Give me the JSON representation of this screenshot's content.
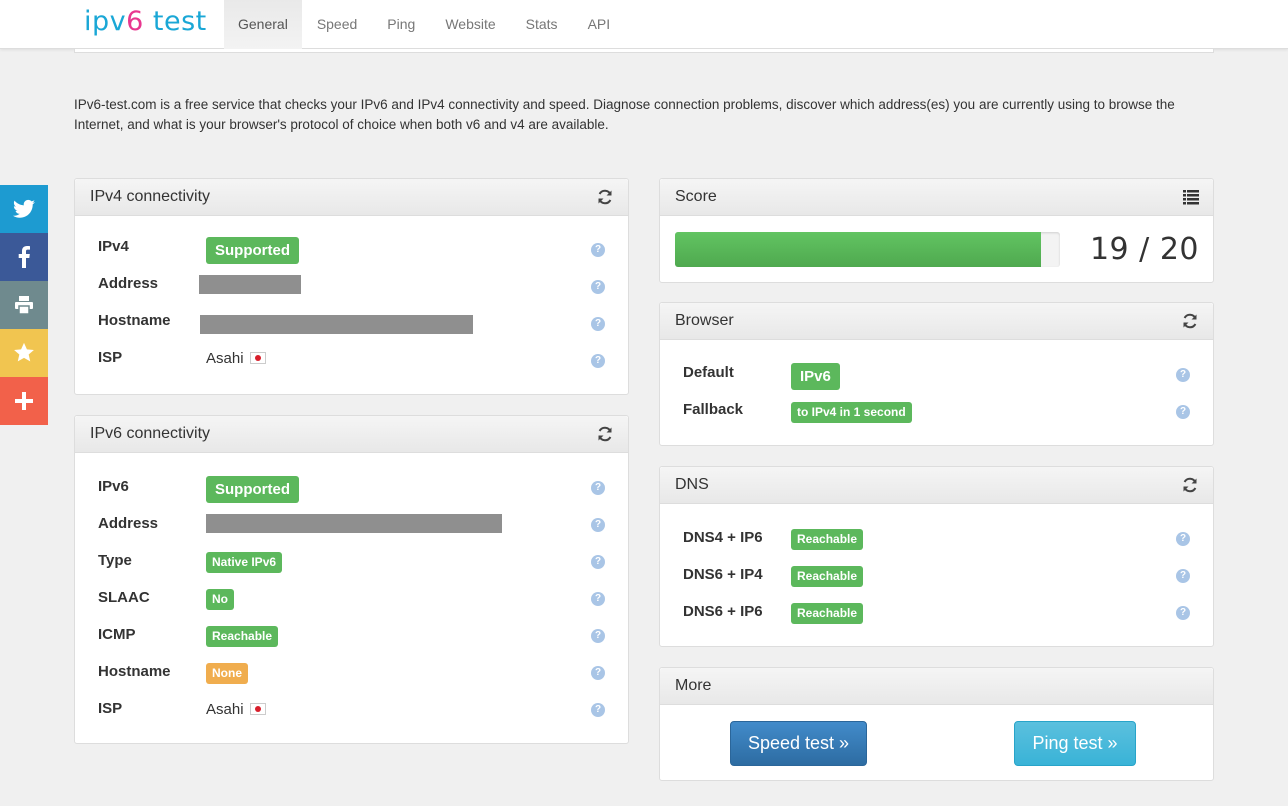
{
  "brand": {
    "part1": "ipv",
    "part2": "6",
    "part3": " test"
  },
  "nav": [
    {
      "label": "General",
      "active": true
    },
    {
      "label": "Speed"
    },
    {
      "label": "Ping"
    },
    {
      "label": "Website"
    },
    {
      "label": "Stats"
    },
    {
      "label": "API"
    }
  ],
  "intro": "IPv6-test.com is a free service that checks your IPv6 and IPv4 connectivity and speed. Diagnose connection problems, discover which address(es) you are currently using to browse the Internet, and what is your browser's protocol of choice when both v6 and v4 are available.",
  "social": [
    {
      "icon": "twitter-icon",
      "color": "#1d9bd1"
    },
    {
      "icon": "facebook-icon",
      "color": "#3b5998"
    },
    {
      "icon": "print-icon",
      "color": "#6f8a8e"
    },
    {
      "icon": "star-icon",
      "color": "#f1c550"
    },
    {
      "icon": "plus-icon",
      "color": "#f2614a"
    }
  ],
  "ipv4": {
    "title": "IPv4 connectivity",
    "rows": {
      "ipv4_label": "IPv4",
      "ipv4_value": "Supported",
      "address_label": "Address",
      "hostname_label": "Hostname",
      "isp_label": "ISP",
      "isp_value": "Asahi"
    }
  },
  "ipv6": {
    "title": "IPv6 connectivity",
    "rows": {
      "ipv6_label": "IPv6",
      "ipv6_value": "Supported",
      "address_label": "Address",
      "type_label": "Type",
      "type_value": "Native IPv6",
      "slaac_label": "SLAAC",
      "slaac_value": "No",
      "icmp_label": "ICMP",
      "icmp_value": "Reachable",
      "hostname_label": "Hostname",
      "hostname_value": "None",
      "isp_label": "ISP",
      "isp_value": "Asahi"
    }
  },
  "score": {
    "title": "Score",
    "text": "19 / 20",
    "fraction": 0.95
  },
  "browser": {
    "title": "Browser",
    "default_label": "Default",
    "default_value": "IPv6",
    "fallback_label": "Fallback",
    "fallback_value": "to IPv4 in 1 second"
  },
  "dns": {
    "title": "DNS",
    "rows": [
      {
        "label": "DNS4 + IP6",
        "value": "Reachable"
      },
      {
        "label": "DNS6 + IP4",
        "value": "Reachable"
      },
      {
        "label": "DNS6 + IP6",
        "value": "Reachable"
      }
    ]
  },
  "more": {
    "title": "More",
    "speed_btn": "Speed test »",
    "ping_btn": "Ping test »"
  },
  "help_glyph": "?",
  "colors": {
    "success": "#5cb85c",
    "warning": "#f0ad4e",
    "primary": "#428bca",
    "info": "#5bc0de"
  }
}
